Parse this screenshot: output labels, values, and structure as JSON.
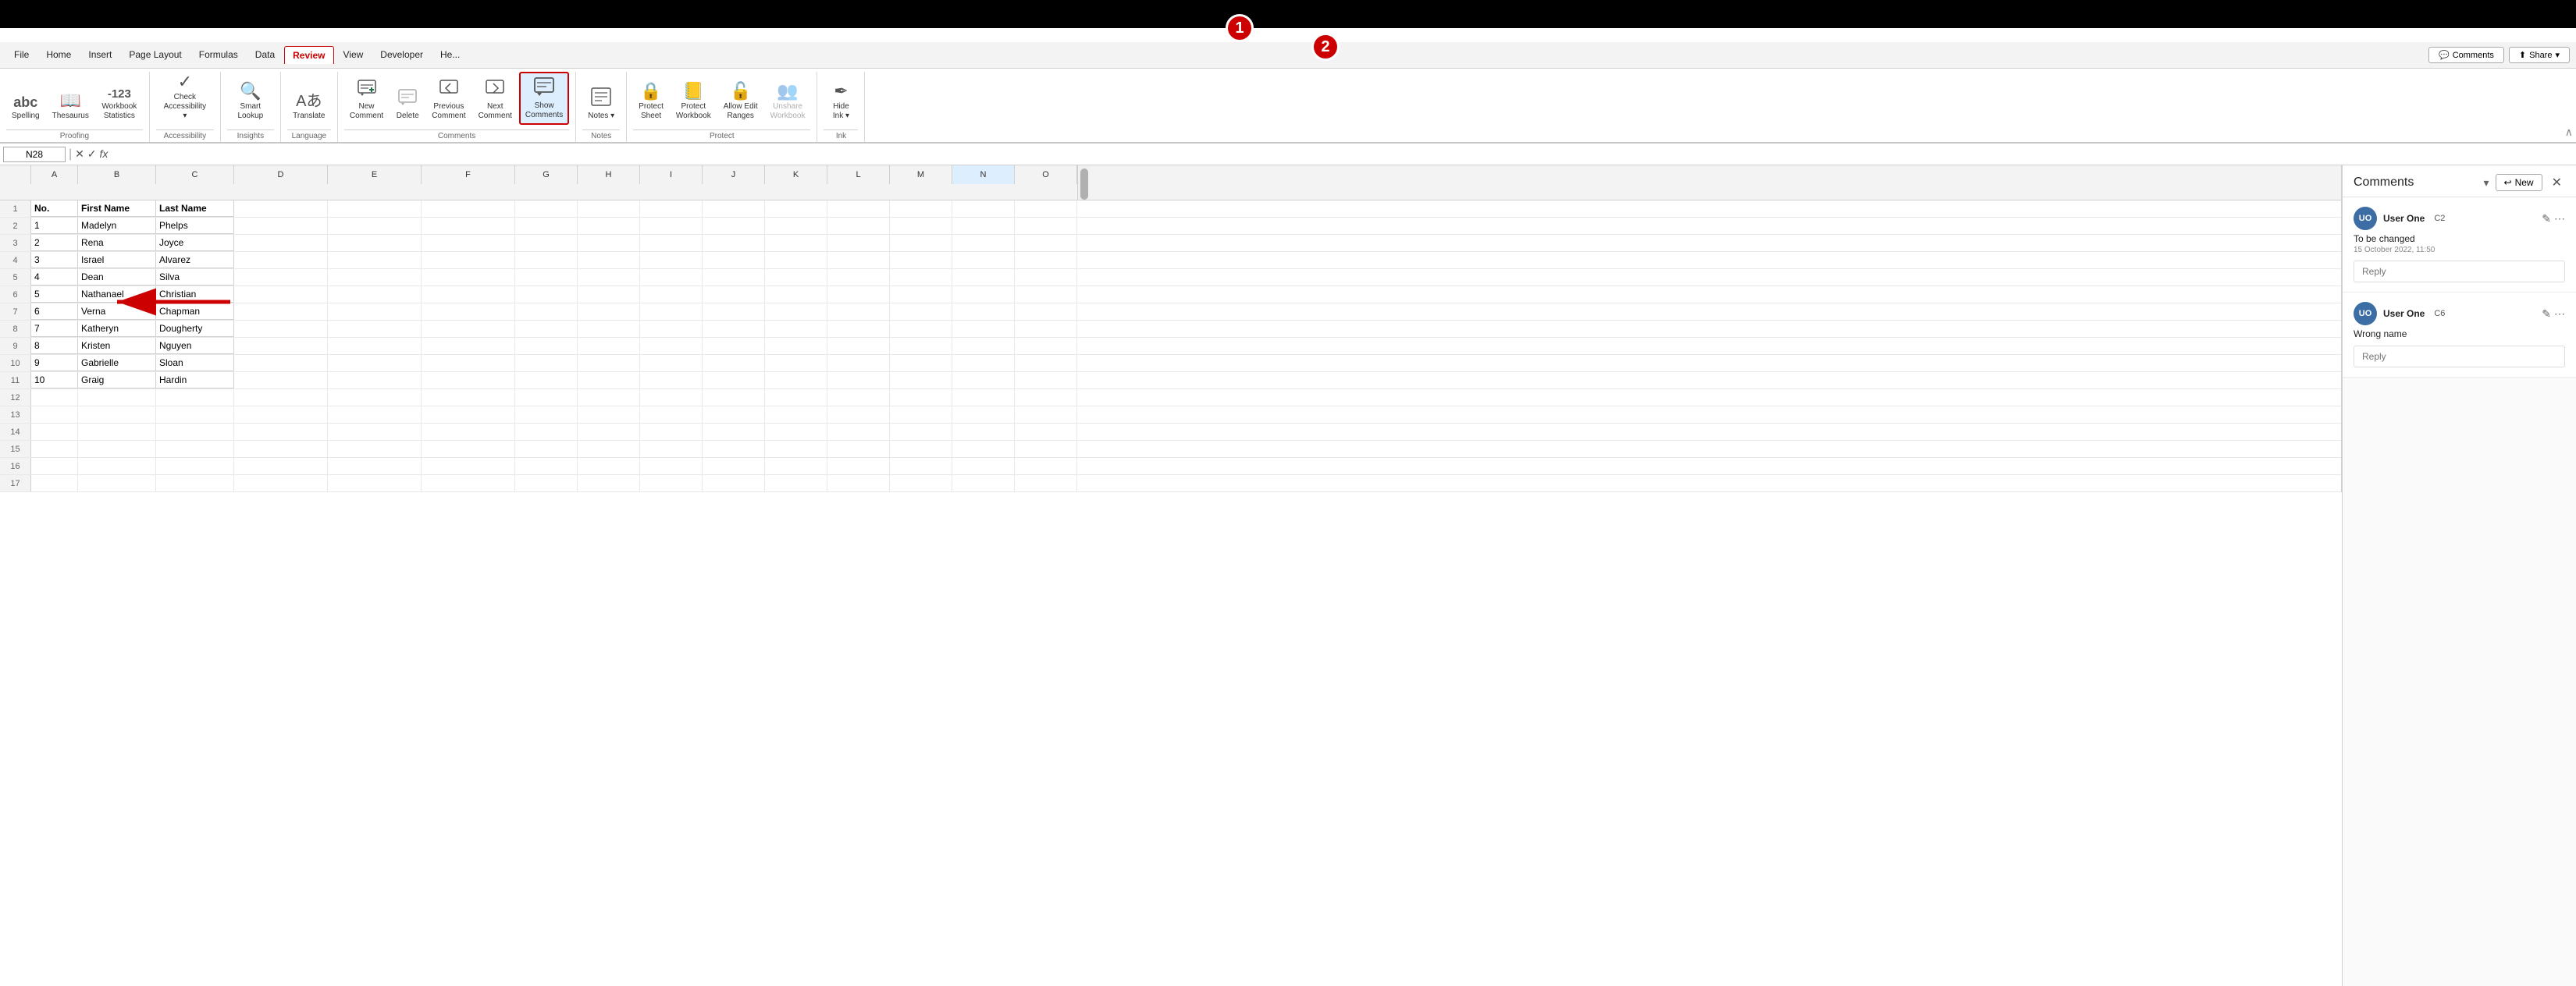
{
  "topBar": {
    "badge1": "1",
    "badge2": "2"
  },
  "menubar": {
    "items": [
      {
        "label": "File",
        "active": false
      },
      {
        "label": "Home",
        "active": false
      },
      {
        "label": "Insert",
        "active": false
      },
      {
        "label": "Page Layout",
        "active": false
      },
      {
        "label": "Formulas",
        "active": false
      },
      {
        "label": "Data",
        "active": false
      },
      {
        "label": "Review",
        "active": true
      },
      {
        "label": "View",
        "active": false
      },
      {
        "label": "Developer",
        "active": false
      },
      {
        "label": "He...",
        "active": false
      }
    ],
    "comments_btn": "Comments",
    "share_btn": "Share"
  },
  "ribbon": {
    "groups": [
      {
        "label": "Proofing",
        "items": [
          {
            "id": "spelling",
            "icon": "abc",
            "label": "Spelling",
            "type": "big"
          },
          {
            "id": "thesaurus",
            "icon": "📖",
            "label": "Thesaurus",
            "type": "big"
          },
          {
            "id": "workbook-stats",
            "icon": "123",
            "label": "Workbook\nStatistics",
            "type": "big"
          }
        ]
      },
      {
        "label": "Accessibility",
        "items": [
          {
            "id": "check-accessibility",
            "icon": "✓",
            "label": "Check\nAccessibility ▾",
            "type": "big"
          }
        ]
      },
      {
        "label": "Insights",
        "items": [
          {
            "id": "smart-lookup",
            "icon": "🔍",
            "label": "Smart\nLookup",
            "type": "big"
          }
        ]
      },
      {
        "label": "Language",
        "items": [
          {
            "id": "translate",
            "icon": "Aあ",
            "label": "Translate",
            "type": "big"
          }
        ]
      },
      {
        "label": "Comments",
        "items": [
          {
            "id": "new-comment",
            "icon": "💬+",
            "label": "New\nComment",
            "type": "big"
          },
          {
            "id": "delete",
            "icon": "🗑",
            "label": "Delete",
            "type": "big"
          },
          {
            "id": "previous-comment",
            "icon": "◀",
            "label": "Previous\nComment",
            "type": "big"
          },
          {
            "id": "next-comment",
            "icon": "▶",
            "label": "Next\nComment",
            "type": "big"
          },
          {
            "id": "show-comments",
            "icon": "💬",
            "label": "Show\nComments",
            "type": "big",
            "active": true
          }
        ]
      },
      {
        "label": "Notes",
        "items": [
          {
            "id": "notes",
            "icon": "📝",
            "label": "Notes ▾",
            "type": "big"
          }
        ]
      },
      {
        "label": "Protect",
        "items": [
          {
            "id": "protect-sheet",
            "icon": "🔒",
            "label": "Protect\nSheet",
            "type": "big"
          },
          {
            "id": "protect-workbook",
            "icon": "📒",
            "label": "Protect\nWorkbook",
            "type": "big"
          },
          {
            "id": "allow-edit-ranges",
            "icon": "🔓",
            "label": "Allow Edit\nRanges",
            "type": "big"
          },
          {
            "id": "unshare-workbook",
            "icon": "👥",
            "label": "Unshare\nWorkbook",
            "type": "big",
            "disabled": true
          }
        ]
      },
      {
        "label": "Ink",
        "items": [
          {
            "id": "hide-ink",
            "icon": "✒",
            "label": "Hide\nInk ▾",
            "type": "big"
          }
        ]
      }
    ]
  },
  "formulaBar": {
    "cellRef": "N28",
    "value": ""
  },
  "sheet": {
    "columns": [
      "A",
      "B",
      "C",
      "D",
      "E",
      "F",
      "G",
      "H",
      "I",
      "J",
      "K",
      "L",
      "M",
      "N",
      "O"
    ],
    "headers": [
      "No.",
      "First Name",
      "Last Name"
    ],
    "rows": [
      {
        "num": 1,
        "a": "No.",
        "b": "First Name",
        "c": "Last Name"
      },
      {
        "num": 2,
        "a": "1",
        "b": "Madelyn",
        "c": "Phelps"
      },
      {
        "num": 3,
        "a": "2",
        "b": "Rena",
        "c": "Joyce"
      },
      {
        "num": 4,
        "a": "3",
        "b": "Israel",
        "c": "Alvarez"
      },
      {
        "num": 5,
        "a": "4",
        "b": "Dean",
        "c": "Silva"
      },
      {
        "num": 6,
        "a": "5",
        "b": "Nathanael",
        "c": "Christian"
      },
      {
        "num": 7,
        "a": "6",
        "b": "Verna",
        "c": "Chapman"
      },
      {
        "num": 8,
        "a": "7",
        "b": "Katheryn",
        "c": "Dougherty"
      },
      {
        "num": 9,
        "a": "8",
        "b": "Kristen",
        "c": "Nguyen"
      },
      {
        "num": 10,
        "a": "9",
        "b": "Gabrielle",
        "c": "Sloan"
      },
      {
        "num": 11,
        "a": "10",
        "b": "Graig",
        "c": "Hardin"
      },
      {
        "num": 12,
        "a": "",
        "b": "",
        "c": ""
      },
      {
        "num": 13,
        "a": "",
        "b": "",
        "c": ""
      },
      {
        "num": 14,
        "a": "",
        "b": "",
        "c": ""
      },
      {
        "num": 15,
        "a": "",
        "b": "",
        "c": ""
      },
      {
        "num": 16,
        "a": "",
        "b": "",
        "c": ""
      },
      {
        "num": 17,
        "a": "",
        "b": "",
        "c": ""
      }
    ]
  },
  "commentsPanel": {
    "title": "Comments",
    "newBtnLabel": "New",
    "comments": [
      {
        "id": "c1",
        "user": "User One",
        "initials": "UO",
        "cellRef": "C2",
        "text": "To be changed",
        "time": "15 October 2022, 11:50",
        "replyPlaceholder": "Reply"
      },
      {
        "id": "c2",
        "user": "User One",
        "initials": "UO",
        "cellRef": "C6",
        "text": "Wrong name",
        "time": "",
        "replyPlaceholder": "Reply"
      }
    ]
  }
}
